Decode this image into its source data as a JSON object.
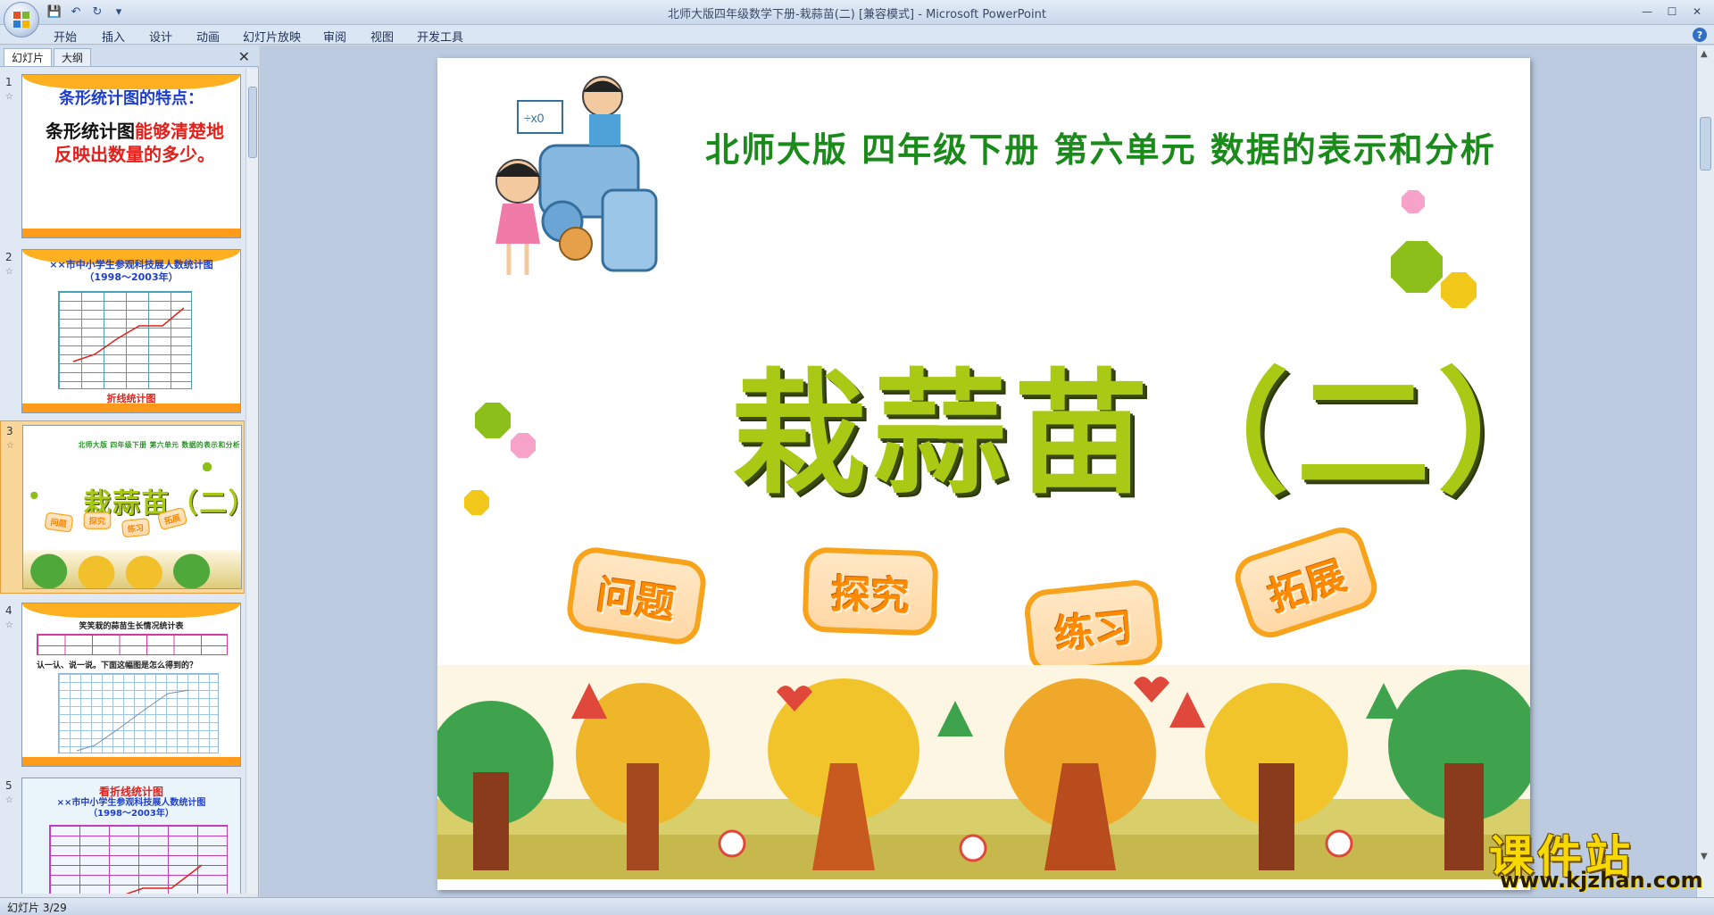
{
  "window": {
    "title": "北师大版四年级数学下册-栽蒜苗(二) [兼容模式] - Microsoft PowerPoint"
  },
  "ribbon": {
    "tabs": [
      "开始",
      "插入",
      "设计",
      "动画",
      "幻灯片放映",
      "审阅",
      "视图",
      "开发工具"
    ]
  },
  "left_panel": {
    "tabs": [
      "幻灯片",
      "大纲"
    ],
    "slides": [
      {
        "num": "1",
        "title": "条形统计图的特点：",
        "line1a": "条形统计图",
        "line1b": "能够清楚地",
        "line2": "反映出数量的多少。"
      },
      {
        "num": "2",
        "title": "××市中小学生参观科技展人数统计图",
        "subtitle": "（1998～2003年）",
        "footer": "折线统计图"
      },
      {
        "num": "3"
      },
      {
        "num": "4",
        "title": "笑笑栽的蒜苗生长情况统计表",
        "note": "认一认、说一说。下面这幅图是怎么得到的？"
      },
      {
        "num": "5",
        "head": "看折线统计图",
        "title": "××市中小学生参观科技展人数统计图",
        "subtitle": "（1998～2003年）"
      }
    ]
  },
  "slide": {
    "subtitle": "北师大版  四年级下册  第六单元  数据的表示和分析",
    "title": "栽蒜苗（二）",
    "buttons": [
      "问题",
      "探究",
      "练习",
      "拓展"
    ]
  },
  "status": {
    "text": "幻灯片 3/29"
  },
  "watermark": {
    "brand": "课件站",
    "url": "www.kjzhan.com"
  },
  "colors": {
    "accent": "#a9c914",
    "subtitle": "#1a8a1a",
    "sticker": "#ff8a00",
    "selected_thumb": "#f9d79a"
  }
}
